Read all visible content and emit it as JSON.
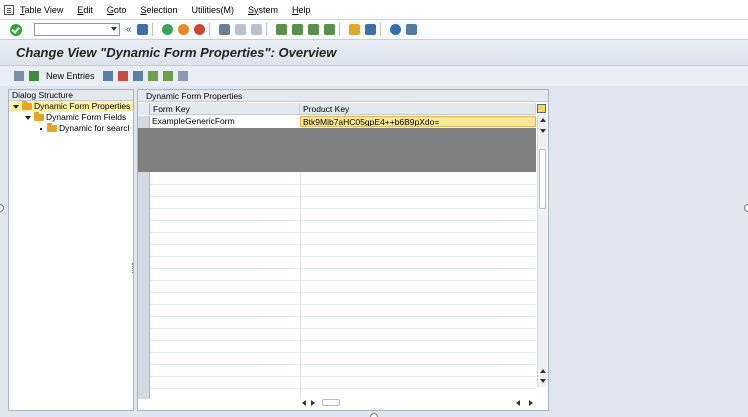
{
  "menubar": {
    "items": [
      {
        "name": "table-view",
        "label_u": "T",
        "label_rest": "able View"
      },
      {
        "name": "edit",
        "label_u": "E",
        "label_rest": "dit"
      },
      {
        "name": "goto",
        "label_u": "G",
        "label_rest": "oto"
      },
      {
        "name": "selection",
        "label_u": "S",
        "label_rest": "election"
      },
      {
        "name": "utilities",
        "label_u": "",
        "label_rest": "Utilities(M)"
      },
      {
        "name": "system",
        "label_u": "Sy",
        "label_rest": "stem"
      },
      {
        "name": "help",
        "label_u": "H",
        "label_rest": "elp"
      }
    ]
  },
  "command_field": {
    "value": ""
  },
  "toolbar_icons": [
    "save-icon",
    "back-icon",
    "exit-icon",
    "cancel-icon",
    "print-icon",
    "find-icon",
    "find-next-icon",
    "first-page-icon",
    "previous-page-icon",
    "next-page-icon",
    "last-page-icon",
    "create-session-icon",
    "shortcut-icon",
    "help-icon",
    "customize-layout-icon"
  ],
  "title": "Change View \"Dynamic Form Properties\": Overview",
  "app_toolbar": {
    "new_entries": "New Entries"
  },
  "dialog_structure": {
    "header": "Dialog Structure",
    "items": [
      {
        "label": "Dynamic Form Properties",
        "level": 0,
        "selected": true
      },
      {
        "label": "Dynamic Form Fields",
        "level": 1,
        "selected": false
      },
      {
        "label": "Dynamic for searcl",
        "level": 2,
        "selected": false
      }
    ]
  },
  "table": {
    "title": "Dynamic Form Properties",
    "columns": [
      "Form Key",
      "Product Key"
    ],
    "rows": [
      {
        "form_key": "ExampleGenericForm",
        "product_key": "Btk9Mib7aHC05gpE4++b6B9pXdo="
      }
    ]
  },
  "colors": {
    "title_bg": "#dbe3ec",
    "selected_tree": "#fff3a6",
    "input_cell": "#ffe79a",
    "gray_overlay": "#808080"
  }
}
